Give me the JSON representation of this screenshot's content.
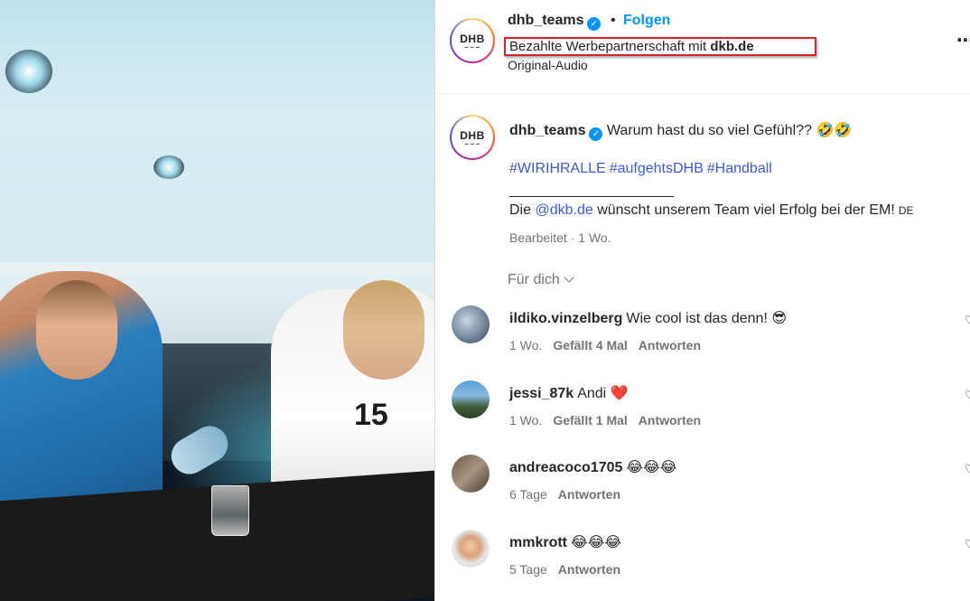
{
  "header": {
    "username": "dhb_teams",
    "dot": "•",
    "follow_label": "Folgen",
    "partner_prefix": "Bezahlte Werbepartnerschaft mit",
    "partner_name": "dkb.de",
    "audio": "Original-Audio",
    "more_label": "⋮",
    "logo_text": "DHB"
  },
  "caption": {
    "username": "dhb_teams",
    "text": "Warum hast du so viel Gefühl??",
    "emojis": "🤣🤣",
    "hashtags": [
      "#WIRIHRALLE",
      "#aufgehtsDHB",
      "#Handball"
    ],
    "wish_prefix": "Die",
    "mention": "@dkb.de",
    "wish_text": "wünscht unserem Team viel Erfolg bei der EM!",
    "flag": "DE",
    "meta": "Bearbeitet · 1 Wo."
  },
  "section": {
    "for_you": "Für dich"
  },
  "comments": [
    {
      "username": "ildiko.vinzelberg",
      "text": "Wie cool ist das denn!",
      "emoji": "😎",
      "time": "1 Wo.",
      "likes": "Gefällt 4 Mal",
      "reply": "Antworten"
    },
    {
      "username": "jessi_87k",
      "text": "Andi",
      "emoji": "❤️",
      "time": "1 Wo.",
      "likes": "Gefällt 1 Mal",
      "reply": "Antworten"
    },
    {
      "username": "andreacoco1705",
      "text": "",
      "emoji": "😂😂😂",
      "time": "6 Tage",
      "likes": "",
      "reply": "Antworten"
    },
    {
      "username": "mmkrott",
      "text": "",
      "emoji": "😂😂😂",
      "time": "5 Tage",
      "likes": "",
      "reply": "Antworten"
    }
  ],
  "media": {
    "jersey_number": "15"
  },
  "colors": {
    "link_blue": "#0095f6",
    "hashtag_blue": "#3d5bd1",
    "highlight_red": "#d8232a",
    "muted_text": "#737373"
  }
}
